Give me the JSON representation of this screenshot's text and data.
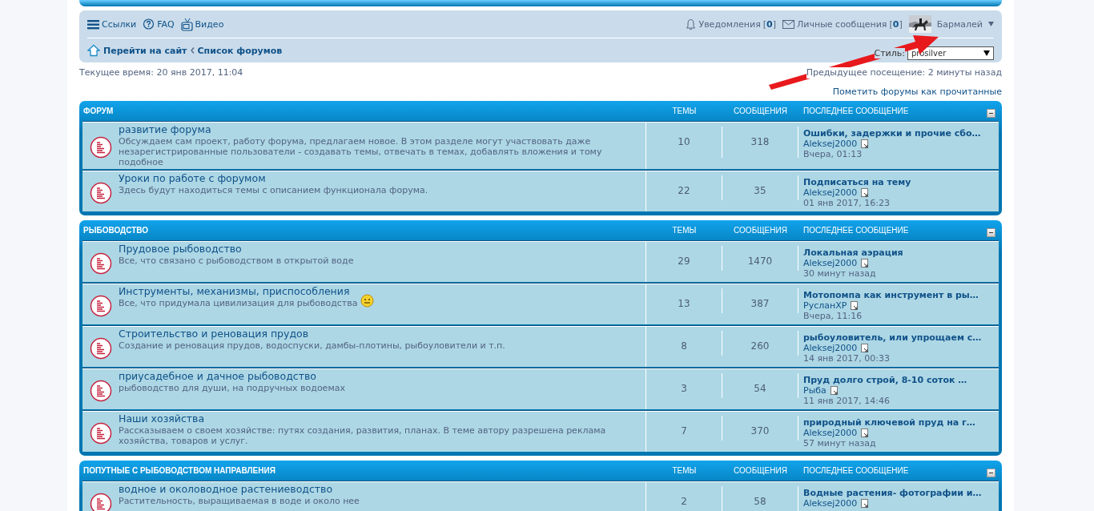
{
  "nav": {
    "links": [
      {
        "kind": "menu",
        "label": "Ссылки"
      },
      {
        "kind": "faq",
        "label": "FAQ"
      },
      {
        "kind": "video",
        "label": "Видео"
      }
    ],
    "notifications": {
      "label": "Уведомления",
      "count": "[**0**]"
    },
    "messages": {
      "label": "Личные сообщения",
      "count": "[**0**]"
    },
    "user": {
      "name": "Бармалей"
    },
    "breadcrumbs": [
      "Перейти на сайт",
      "Список форумов"
    ],
    "style": {
      "label": "Стиль:",
      "value": "prosilver"
    }
  },
  "current_time": "Текущее время: 20 янв 2017, 11:04",
  "last_visit": "Предыдущее посещение: 2 минуты назад",
  "mark_read": "Пометить форумы как прочитанные",
  "sections": [
    {
      "title": "ФОРУМ",
      "columns": [
        "ТЕМЫ",
        "СООБЩЕНИЯ",
        "ПОСЛЕДНЕЕ СООБЩЕНИЕ"
      ],
      "forums": [
        {
          "title": "развитие форума",
          "description": "Обсуждаем сам проект, работу форума, предлагаем новое. В этом разделе могут участвовать даже незарегистрированные пользователи - создавать темы, отвечать в темах, добавлять вложения и тому подобное",
          "smiley": false,
          "topics": "10",
          "posts": "318",
          "last_post": {
            "title": "Ошибки, задержки и прочие сбо…",
            "author": "Aleksej2000",
            "time": "Вчера, 01:13"
          }
        },
        {
          "title": "Уроки по работе с форумом",
          "description": "Здесь будут находиться темы с описанием функционала форума.",
          "smiley": false,
          "topics": "22",
          "posts": "35",
          "last_post": {
            "title": "Подписаться на тему",
            "author": "Aleksej2000",
            "time": "01 янв 2017, 16:23"
          }
        }
      ]
    },
    {
      "title": "РЫБОВОДСТВО",
      "columns": [
        "ТЕМЫ",
        "СООБЩЕНИЯ",
        "ПОСЛЕДНЕЕ СООБЩЕНИЕ"
      ],
      "forums": [
        {
          "title": "Прудовое рыбоводство",
          "description": "Все, что связано с рыбоводством в открытой воде",
          "smiley": false,
          "topics": "29",
          "posts": "1470",
          "last_post": {
            "title": "Локальная аэрация",
            "author": "Aleksej2000",
            "time": "30 минут назад"
          }
        },
        {
          "title": "Инструменты, механизмы, приспособления",
          "description": "Все, что придумала цивилизация для рыбоводства",
          "smiley": true,
          "topics": "13",
          "posts": "387",
          "last_post": {
            "title": "Мотопомпа как инструмент в ры…",
            "author": "РусланXP",
            "time": "Вчера, 11:16"
          }
        },
        {
          "title": "Строительство и реновация прудов",
          "description": "Создание и реновация прудов, водоспуски, дамбы-плотины, рыбоуловители и т.п.",
          "smiley": false,
          "topics": "8",
          "posts": "260",
          "last_post": {
            "title": "рыбоуловитель, или упрощаем с…",
            "author": "Aleksej2000",
            "time": "14 янв 2017, 00:33"
          }
        },
        {
          "title": "приусадебное и дачное рыбоводство",
          "description": "рыбоводство для души, на подручных водоемах",
          "smiley": false,
          "topics": "3",
          "posts": "54",
          "last_post": {
            "title": "Пруд долго строй, 8-10 соток …",
            "author": "Рыба",
            "time": "11 янв 2017, 14:46"
          }
        },
        {
          "title": "Наши хозяйства",
          "description": "Рассказываем о своем хозяйстве: путях создания, развития, планах. В теме автору разрешена реклама хозяйства, товаров и услуг.",
          "smiley": false,
          "topics": "7",
          "posts": "370",
          "last_post": {
            "title": "природный ключевой пруд на г…",
            "author": "Aleksej2000",
            "time": "57 минут назад"
          }
        }
      ]
    },
    {
      "title": "ПОПУТНЫЕ С РЫБОВОДСТВОМ НАПРАВЛЕНИЯ",
      "columns": [
        "ТЕМЫ",
        "СООБЩЕНИЯ",
        "ПОСЛЕДНЕЕ СООБЩЕНИЕ"
      ],
      "forums": [
        {
          "title": "водное и околоводное растениеводство",
          "description": "Растительность, выращиваемая в воде и около нее",
          "smiley": false,
          "topics": "2",
          "posts": "58",
          "last_post": {
            "title": "Водные растения- фотографии и…",
            "author": "Aleksej2000"
          }
        }
      ]
    }
  ]
}
